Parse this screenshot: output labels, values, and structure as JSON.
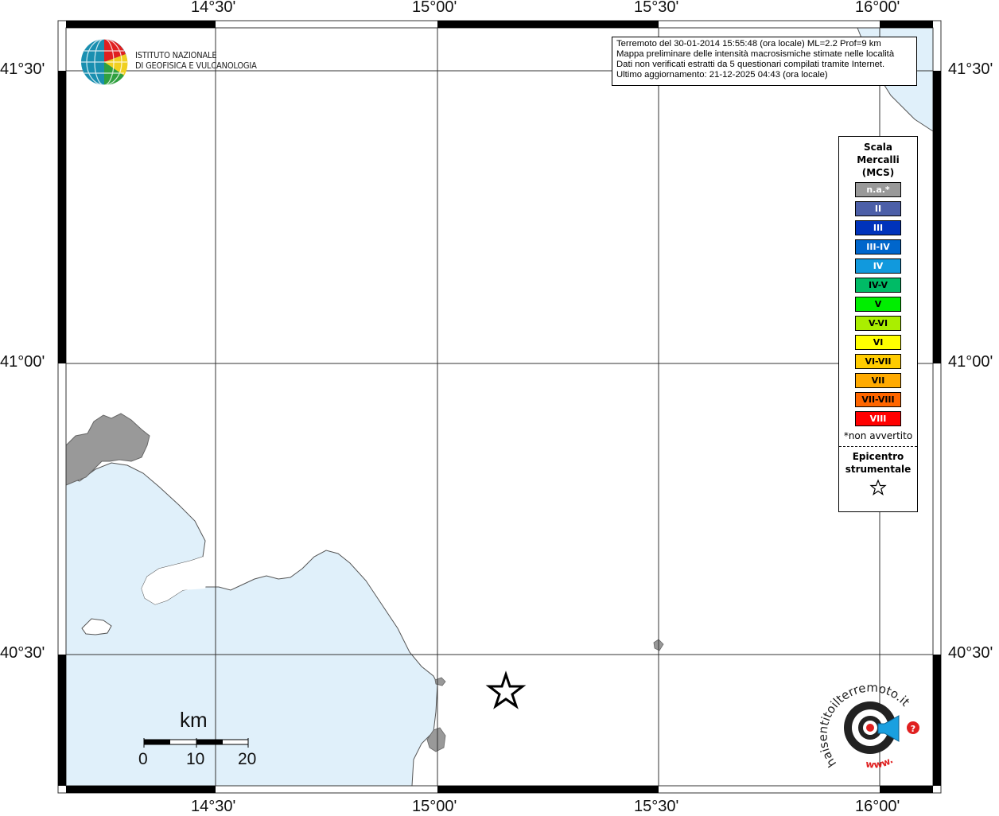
{
  "map": {
    "lon_labels": [
      "14°30'",
      "15°00'",
      "15°30'",
      "16°00'"
    ],
    "lat_labels": [
      "41°30'",
      "41°00'",
      "40°30'"
    ],
    "sea_color": "#e0f0fa",
    "land_color": "#ffffff",
    "urban_color": "#999999",
    "epicenter": {
      "symbol": "star"
    }
  },
  "logo_ingv": {
    "line1": "ISTITUTO NAZIONALE",
    "line2": "DI GEOFISICA E VULCANOLOGIA"
  },
  "info": {
    "line1": "Terremoto del 30-01-2014 15:55:48 (ora locale) ML=2.2 Prof=9 km",
    "line2": "Mappa preliminare delle intensità macrosismiche stimate nelle località",
    "line3": "Dati non verificati estratti da 5 questionari compilati tramite Internet.",
    "line4": "Ultimo aggiornamento: 21-12-2025 04:43 (ora locale)"
  },
  "legend": {
    "title1": "Scala",
    "title2": "Mercalli",
    "title3": "(MCS)",
    "items": [
      {
        "label": "n.a.*",
        "color": "#999999"
      },
      {
        "label": "II",
        "color": "#4c5fa8"
      },
      {
        "label": "III",
        "color": "#0033bb"
      },
      {
        "label": "III-IV",
        "color": "#0066cc"
      },
      {
        "label": "IV",
        "color": "#1199dd"
      },
      {
        "label": "IV-V",
        "color": "#00bb66"
      },
      {
        "label": "V",
        "color": "#00ee00"
      },
      {
        "label": "V-VI",
        "color": "#aaee00"
      },
      {
        "label": "VI",
        "color": "#ffff00"
      },
      {
        "label": "VI-VII",
        "color": "#ffcc00"
      },
      {
        "label": "VII",
        "color": "#ffaa00"
      },
      {
        "label": "VII-VIII",
        "color": "#ff6600"
      },
      {
        "label": "VIII",
        "color": "#ff0000"
      }
    ],
    "note": "*non avvertito",
    "epi1": "Epicentro",
    "epi2": "strumentale"
  },
  "scale_bar": {
    "unit": "km",
    "ticks": [
      "0",
      "10",
      "20"
    ]
  },
  "hst_logo": {
    "text": "haisentitoilterremoto.it",
    "www": "www."
  }
}
